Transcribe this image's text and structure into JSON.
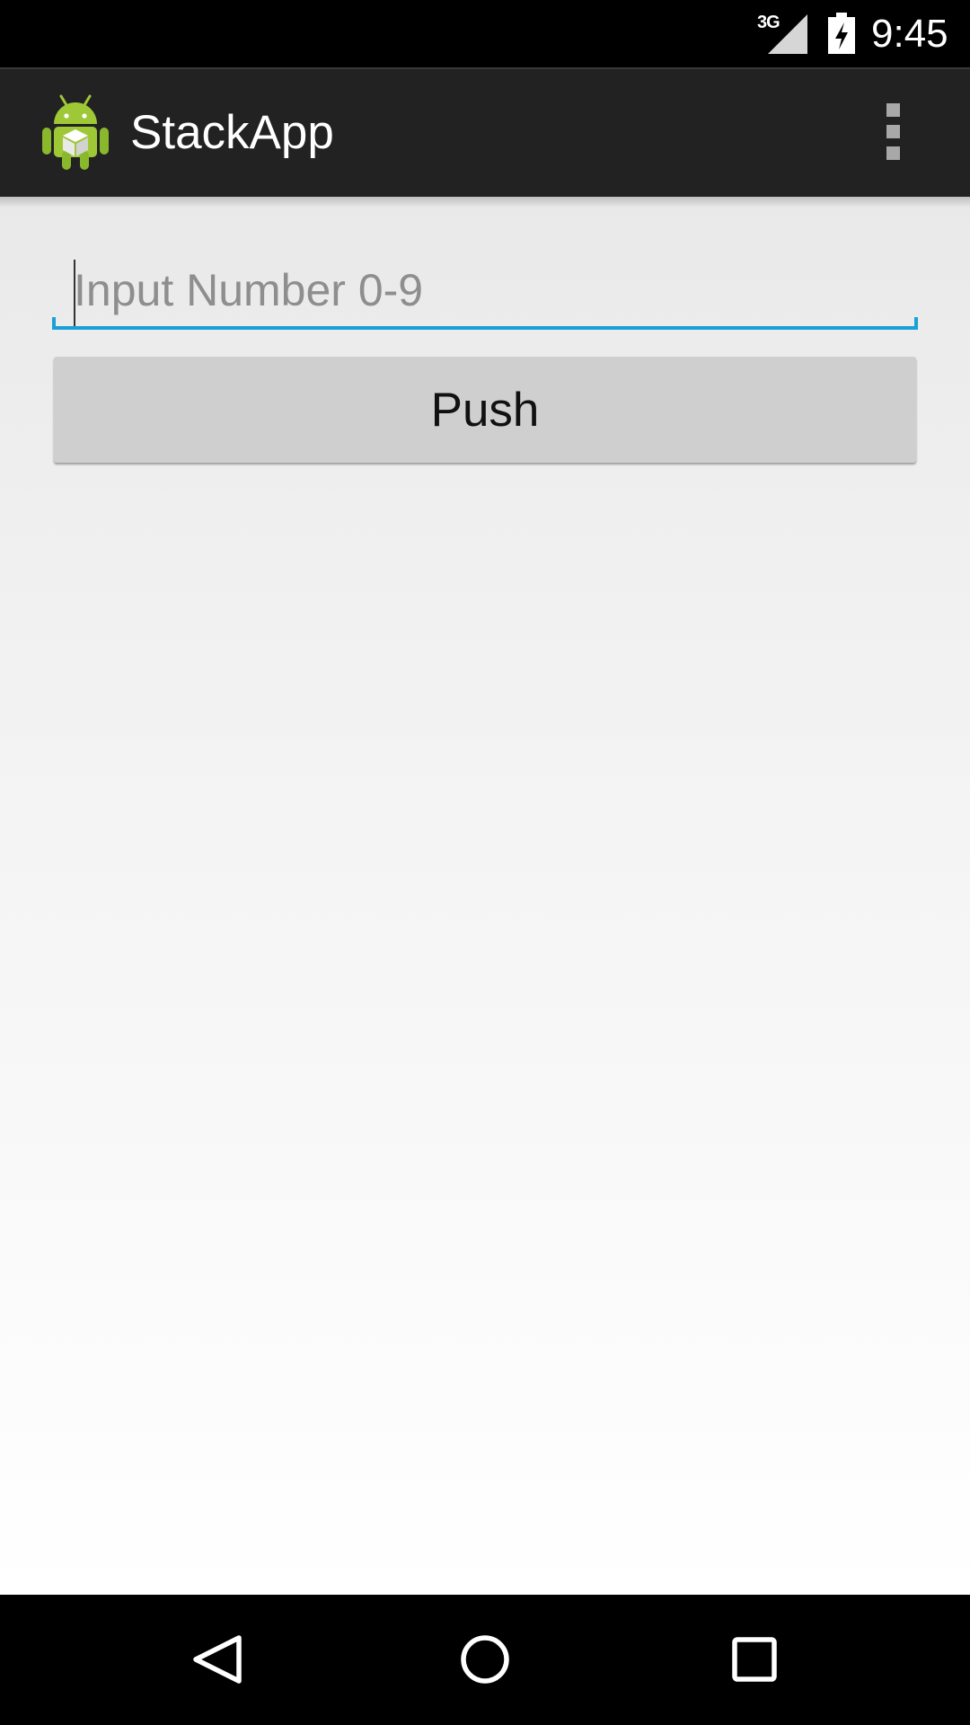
{
  "status_bar": {
    "network_type": "3G",
    "time": "9:45",
    "icons": [
      "signal-icon",
      "battery-charging-icon"
    ]
  },
  "action_bar": {
    "title": "StackApp",
    "app_icon": "android-app-icon",
    "overflow_icon": "overflow-menu-icon"
  },
  "form": {
    "number_input": {
      "placeholder": "Input Number 0-9",
      "value": ""
    },
    "push_button_label": "Push"
  },
  "navigation_bar": {
    "icons": [
      "back-icon",
      "home-icon",
      "recents-icon"
    ]
  },
  "colors": {
    "accent": "#1aa0d8",
    "action_bar": "#222222",
    "button": "#cfcfcf"
  }
}
